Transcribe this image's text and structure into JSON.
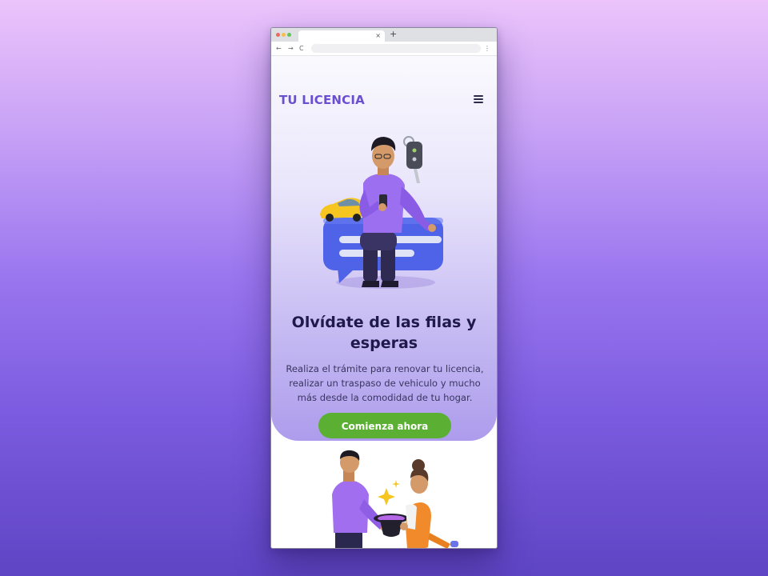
{
  "browser": {
    "tab_close": "×",
    "new_tab": "+",
    "back": "←",
    "forward": "→",
    "reload": "C",
    "menu": "⋮"
  },
  "site": {
    "logo": "TU LICENCIA"
  },
  "hero": {
    "title": "Olvídate de las filas y esperas",
    "description": "Realiza el trámite para renovar tu licencia, realizar un traspaso de vehiculo y mucho más desde la comodidad de tu hogar.",
    "cta_label": "Comienza ahora"
  },
  "colors": {
    "brand": "#6a4fd0",
    "cta": "#5bb034",
    "title": "#1f1a4b"
  },
  "icons": [
    "hamburger-menu-icon"
  ]
}
